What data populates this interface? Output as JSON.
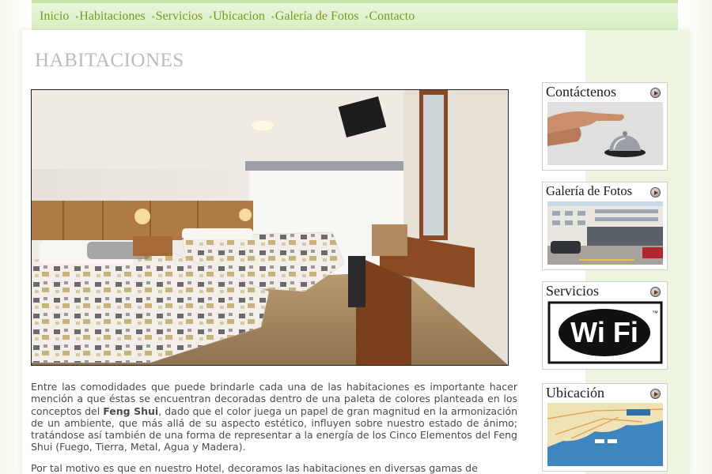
{
  "nav": {
    "items": [
      {
        "label": "Inicio"
      },
      {
        "label": "Habitaciones"
      },
      {
        "label": "Servicios"
      },
      {
        "label": "Ubicacion"
      },
      {
        "label": "Galería de Fotos"
      },
      {
        "label": "Contacto"
      }
    ],
    "bullet": "■"
  },
  "page": {
    "title": "HABITACIONES"
  },
  "content": {
    "p1_a": "Entre las comodidades que puede brindarle cada una de las habitaciones es importante hacer mención a que éstas se encuentran decoradas dentro de una paleta de colores planteada en los conceptos del ",
    "p1_bold": "Feng Shui",
    "p1_b": ", dado que el color juega un papel de gran magnitud en la armonización de un ambiente, que más allá de su aspecto estético, influyen sobre nuestro estado de ánimo; tratándose así también de una forma de representar a la energía de los Cinco Elementos del Feng Shui (Fuego, Tierra, Metal, Agua y Madera).",
    "p2": "Por tal motivo es que en nuestro Hotel, decoramos las habitaciones en diversas gamas de"
  },
  "sidebar": {
    "contact_title": "Contáctenos",
    "gallery_title": "Galería de Fotos",
    "services_title": "Servicios",
    "wifi_text": "Wi Fi",
    "wifi_tm": "™",
    "location_title": "Ubicación"
  },
  "colors": {
    "nav_text": "#7a9a1c",
    "title_gray": "#bcbcbc",
    "sidebar_bg": "#ecf5e0"
  }
}
